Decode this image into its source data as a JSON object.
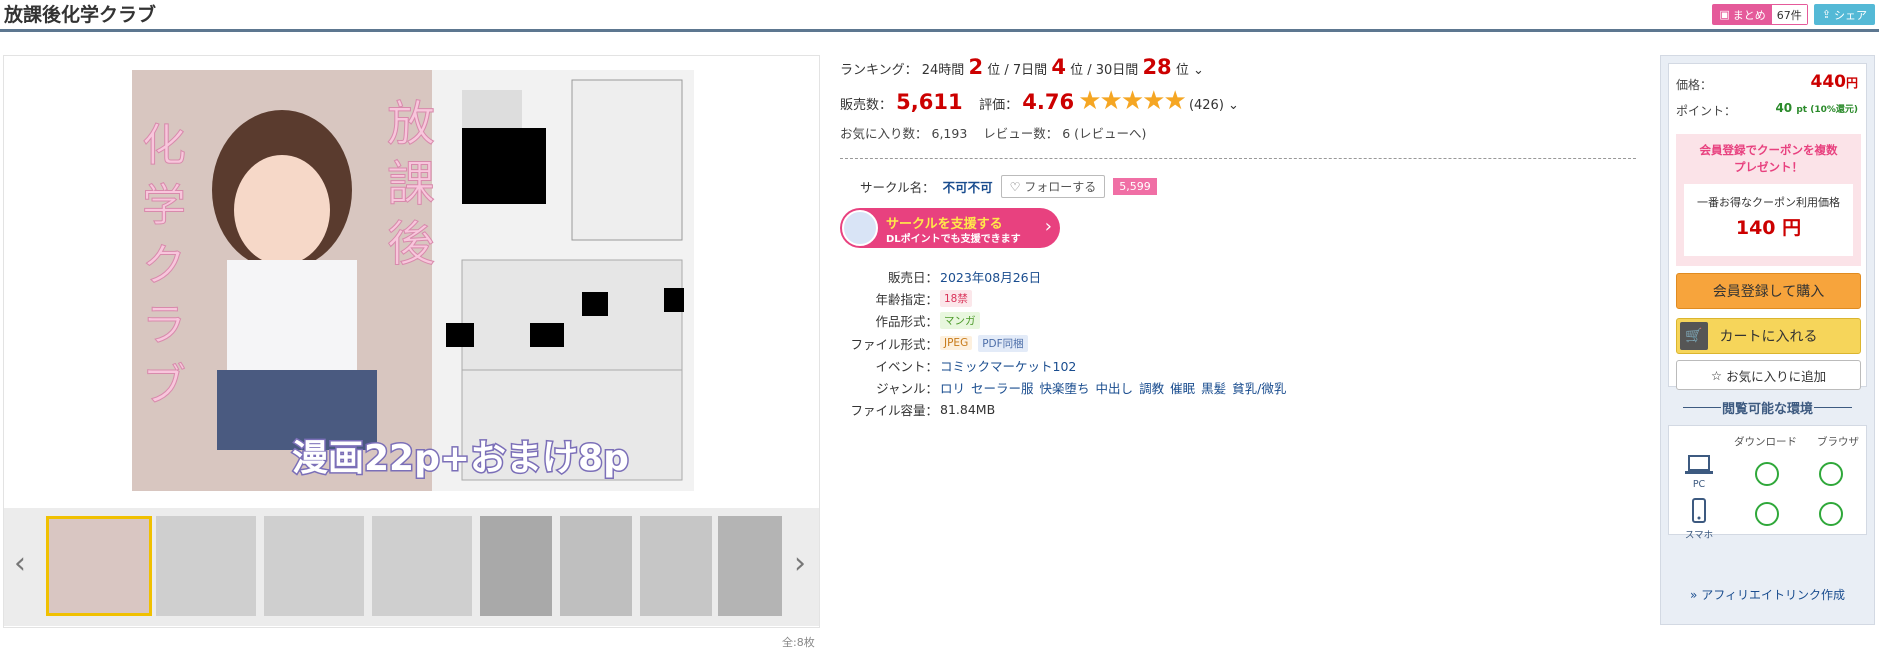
{
  "header": {
    "title": "放課後化学クラブ",
    "matome_label": "まとめ",
    "matome_count": "67件",
    "share_label": "シェア"
  },
  "gallery": {
    "main_image_alt": "",
    "total": "全:8枚",
    "thumb_count": 8
  },
  "ranking": {
    "label": "ランキング：",
    "h24_label": "24時間",
    "h24_value": "2",
    "d7_label": "7日間",
    "d7_value": "4",
    "d30_label": "30日間",
    "d30_value": "28",
    "unit": "位"
  },
  "sales": {
    "label": "販売数：",
    "value": "5,611",
    "rating_label": "評価：",
    "rating_value": "4.76",
    "stars": "★★★★★",
    "rating_count": "(426)"
  },
  "favorites": {
    "fav_label": "お気に入り数：",
    "fav_value": "6,193",
    "review_label": "レビュー数：",
    "review_value": "6",
    "review_link": "(レビューへ)"
  },
  "circle": {
    "label": "サークル名：",
    "name": "不可不可",
    "follow_label": "フォローする",
    "follow_count": "5,599",
    "support_title": "サークルを支援する",
    "support_sub": "DLポイントでも支援できます"
  },
  "specs": [
    {
      "key": "販売日：",
      "value": "2023年08月26日"
    },
    {
      "key": "年齢指定：",
      "value": "18禁"
    },
    {
      "key": "作品形式：",
      "value": "マンガ"
    },
    {
      "key": "ファイル形式：",
      "value": "JPEG",
      "value2": "PDF同梱"
    },
    {
      "key": "イベント：",
      "value": "コミックマーケット102"
    },
    {
      "key": "ジャンル：",
      "values": [
        "ロリ",
        "セーラー服",
        "快楽堕ち",
        "中出し",
        "調教",
        "催眠",
        "黒髪",
        "貧乳/微乳"
      ]
    },
    {
      "key": "ファイル容量：",
      "value": "81.84MB"
    }
  ],
  "purchase": {
    "price_label": "価格：",
    "price_value": "440",
    "price_unit": "円",
    "point_label": "ポイント：",
    "point_value": "40",
    "point_unit": "pt (10%還元)",
    "coupon_head1": "会員登録でクーポンを複数",
    "coupon_head2": "プレゼント！",
    "coupon_label": "一番お得なクーポン利用価格",
    "coupon_price": "140 円",
    "member_button": "会員登録して購入",
    "cart_button": "カートに入れる",
    "fav_button": "お気に入りに追加"
  },
  "environment": {
    "heading": "閲覧可能な環境",
    "col_download": "ダウンロード",
    "col_browser": "ブラウザ",
    "pc_label": "PC",
    "phone_label": "スマホ",
    "affiliate": "アフィリエイトリンク作成"
  },
  "colors": {
    "accent_red": "#cc0000",
    "star": "#f5a623",
    "pink": "#e8417f",
    "green_ok": "#2fa83a"
  }
}
